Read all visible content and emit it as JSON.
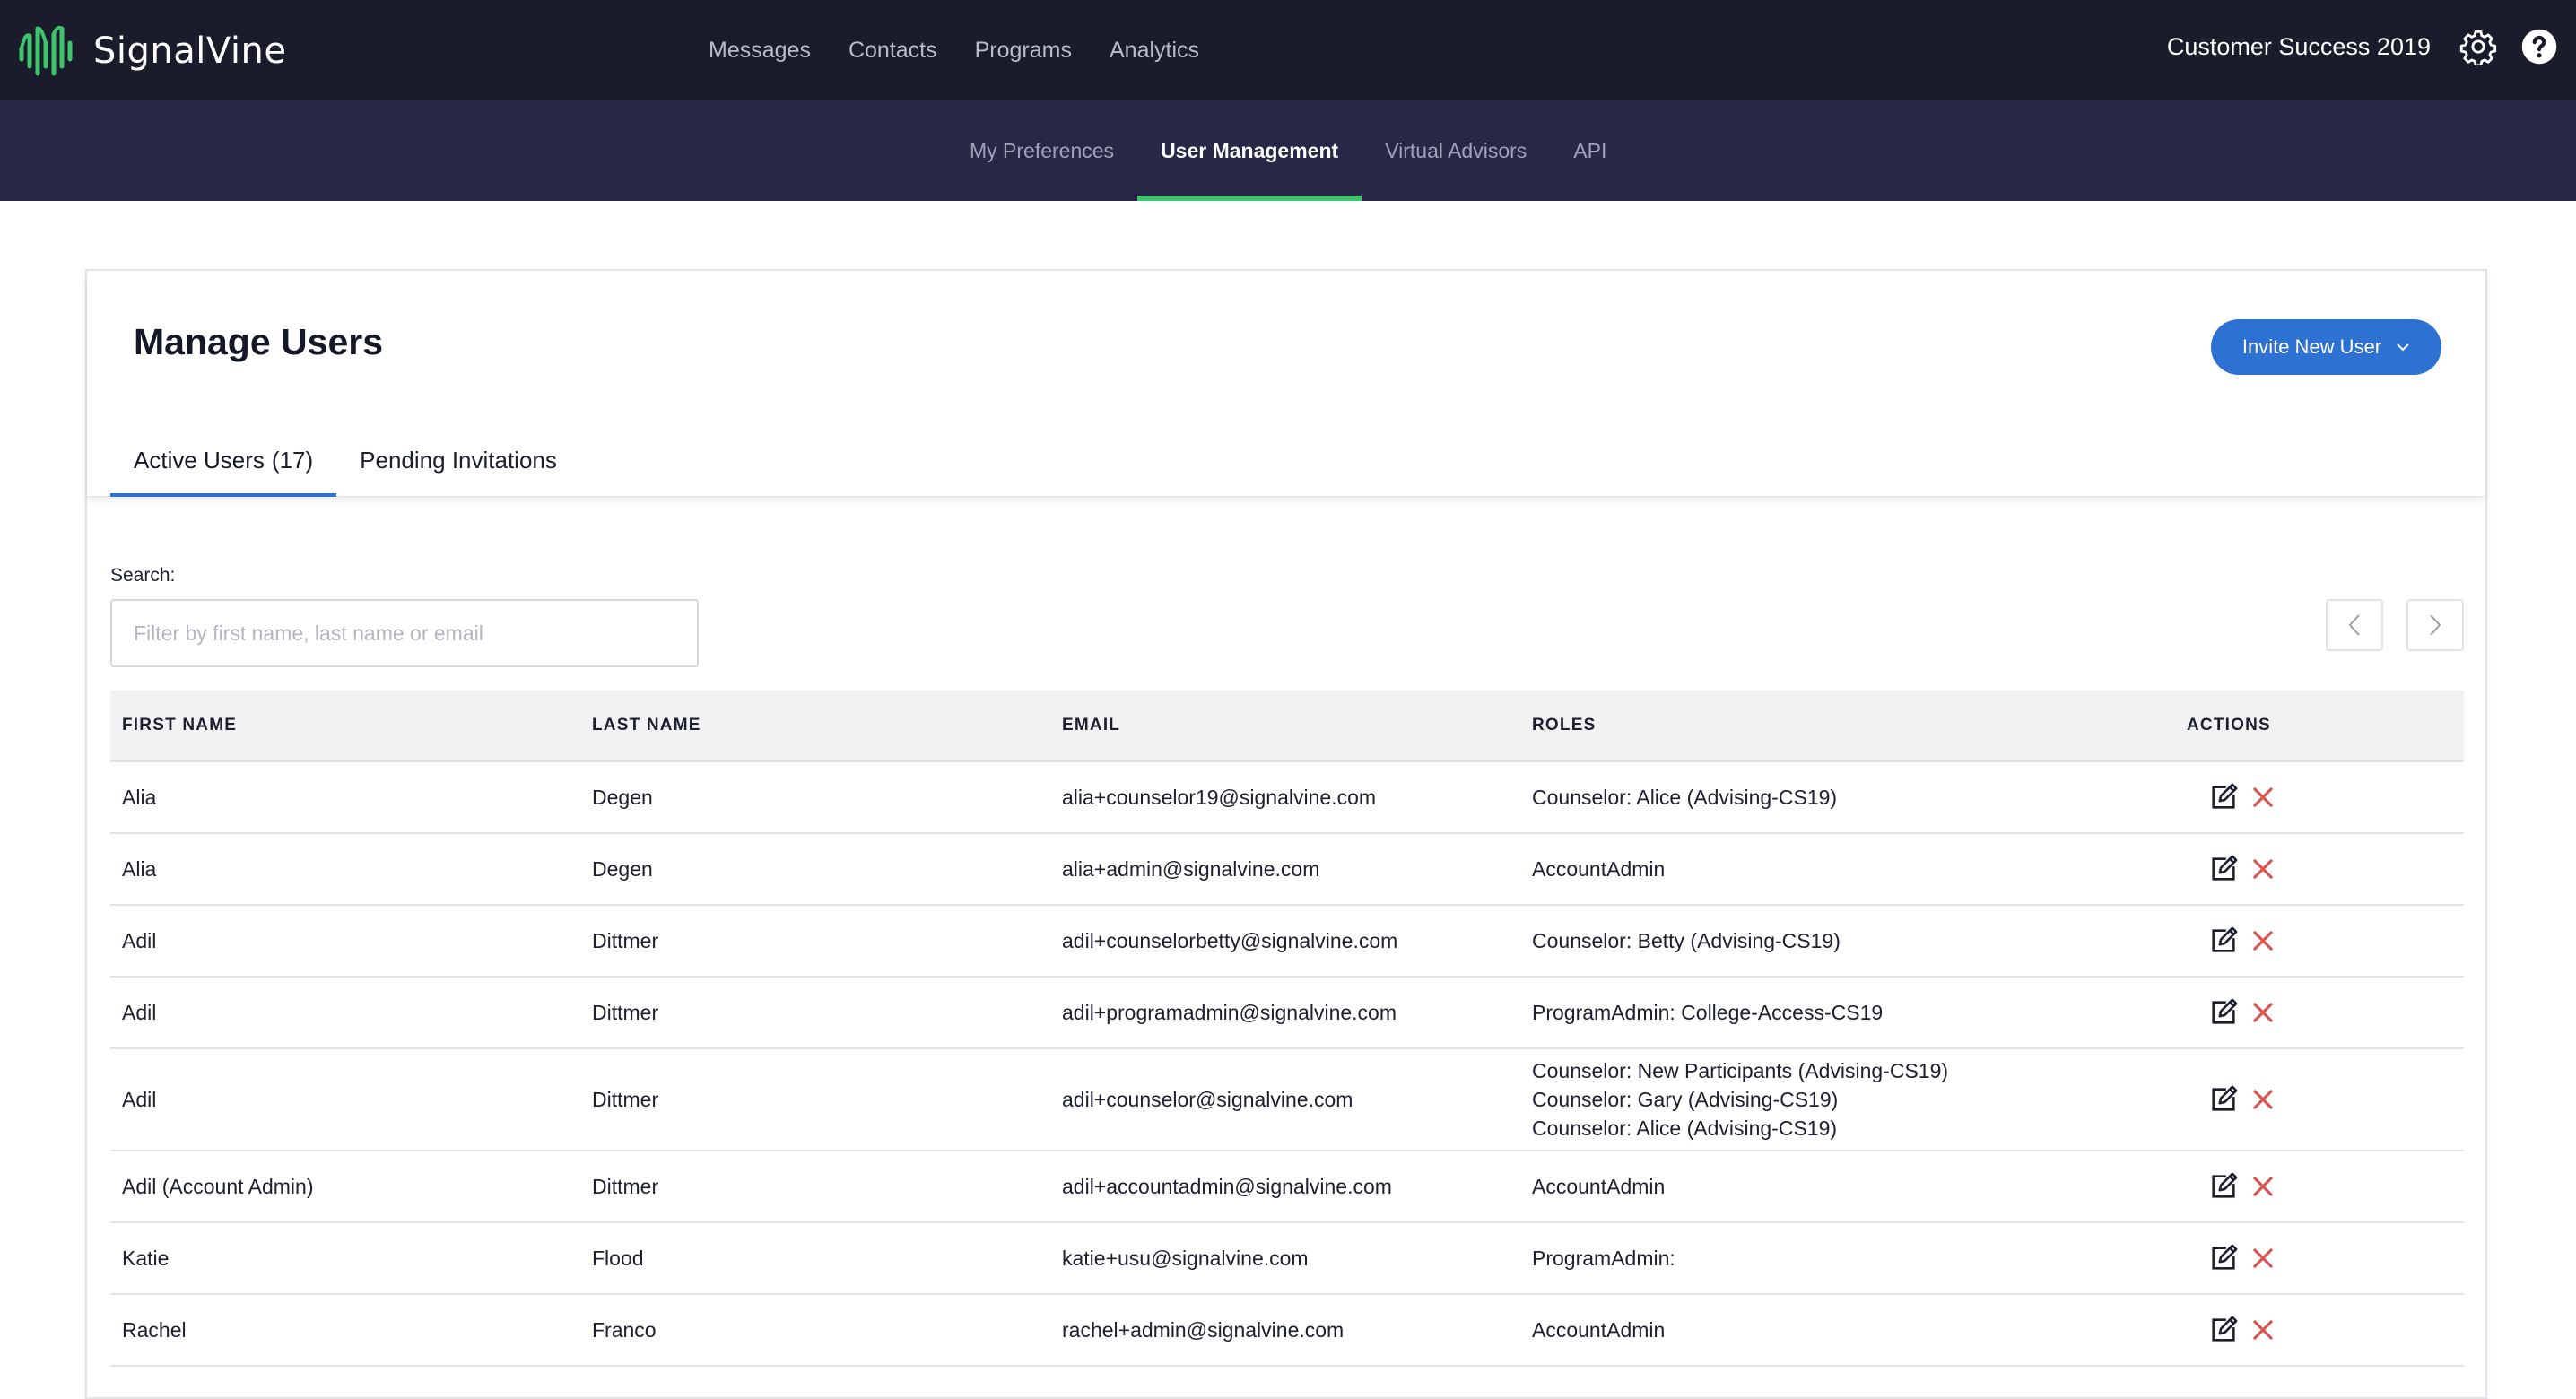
{
  "app": {
    "brand": "SignalVine",
    "brand_color": "#3fc56d",
    "accent_color": "#2d72d2",
    "org_name": "Customer Success 2019"
  },
  "main_nav": [
    {
      "label": "Messages"
    },
    {
      "label": "Contacts"
    },
    {
      "label": "Programs"
    },
    {
      "label": "Analytics"
    }
  ],
  "sub_nav": [
    {
      "label": "My Preferences",
      "active": false
    },
    {
      "label": "User Management",
      "active": true
    },
    {
      "label": "Virtual Advisors",
      "active": false
    },
    {
      "label": "API",
      "active": false
    }
  ],
  "icons": {
    "settings": "gear-icon",
    "help": "question-icon",
    "edit": "edit-icon",
    "delete": "close-icon"
  },
  "page": {
    "title": "Manage Users",
    "invite_button": "Invite New User",
    "tabs": [
      {
        "label": "Active Users",
        "count": "(17)",
        "active": true
      },
      {
        "label": "Pending Invitations",
        "count": "",
        "active": false
      }
    ],
    "search": {
      "label": "Search:",
      "placeholder": "Filter by first name, last name or email",
      "value": ""
    }
  },
  "table": {
    "columns": [
      "FIRST NAME",
      "LAST NAME",
      "EMAIL",
      "ROLES",
      "ACTIONS"
    ],
    "rows": [
      {
        "first": "Alia",
        "last": "Degen",
        "email": "alia+counselor19@signalvine.com",
        "roles": [
          "Counselor: Alice (Advising-CS19)"
        ]
      },
      {
        "first": "Alia",
        "last": "Degen",
        "email": "alia+admin@signalvine.com",
        "roles": [
          "AccountAdmin"
        ]
      },
      {
        "first": "Adil",
        "last": "Dittmer",
        "email": "adil+counselorbetty@signalvine.com",
        "roles": [
          "Counselor: Betty (Advising-CS19)"
        ]
      },
      {
        "first": "Adil",
        "last": "Dittmer",
        "email": "adil+programadmin@signalvine.com",
        "roles": [
          "ProgramAdmin: College-Access-CS19"
        ]
      },
      {
        "first": "Adil",
        "last": "Dittmer",
        "email": "adil+counselor@signalvine.com",
        "roles": [
          "Counselor: New Participants (Advising-CS19)",
          "Counselor: Gary (Advising-CS19)",
          "Counselor: Alice (Advising-CS19)"
        ]
      },
      {
        "first": "Adil (Account Admin)",
        "last": "Dittmer",
        "email": "adil+accountadmin@signalvine.com",
        "roles": [
          "AccountAdmin"
        ]
      },
      {
        "first": "Katie",
        "last": "Flood",
        "email": "katie+usu@signalvine.com",
        "roles": [
          "ProgramAdmin:"
        ]
      },
      {
        "first": "Rachel",
        "last": "Franco",
        "email": "rachel+admin@signalvine.com",
        "roles": [
          "AccountAdmin"
        ]
      }
    ]
  }
}
